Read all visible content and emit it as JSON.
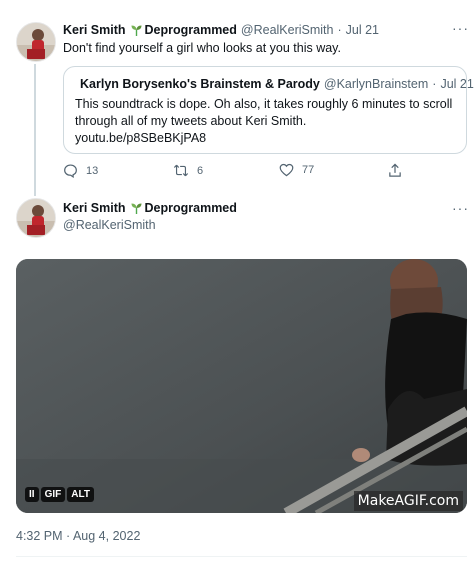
{
  "colors": {
    "accent": "#1d9bf0",
    "secondary_text": "#536471",
    "border": "#cfd9de",
    "sprout": "#4fa84d"
  },
  "reply_tweet": {
    "author_name": "Keri Smith",
    "author_suffix": "Deprogrammed",
    "handle": "@RealKeriSmith",
    "separator": "·",
    "date": "Jul 21",
    "more_icon": "more-horizontal-icon",
    "text": "Don't find yourself a girl who looks at you this way.",
    "quote": {
      "author_name": "Karlyn Borysenko's Brainstem & Parody",
      "handle": "@KarlynBrainstem",
      "separator": "·",
      "date": "Jul 21",
      "text_line1": "This soundtrack is dope. Oh also, it takes roughly 6 minutes to scroll",
      "text_line2": "through all of my tweets about Keri Smith.",
      "link": "youtu.be/p8SBeBKjPA8"
    },
    "actions": {
      "reply_count": "13",
      "retweet_count": "6",
      "like_count": "77"
    }
  },
  "main_tweet": {
    "author_name": "Keri Smith",
    "author_suffix": "Deprogrammed",
    "handle": "@RealKeriSmith",
    "more_icon": "more-horizontal-icon",
    "media": {
      "pause_label": "II",
      "gif_label": "GIF",
      "alt_label": "ALT",
      "watermark": "MakeAGIF.com"
    },
    "timestamp": "4:32 PM · Aug 4, 2022"
  }
}
